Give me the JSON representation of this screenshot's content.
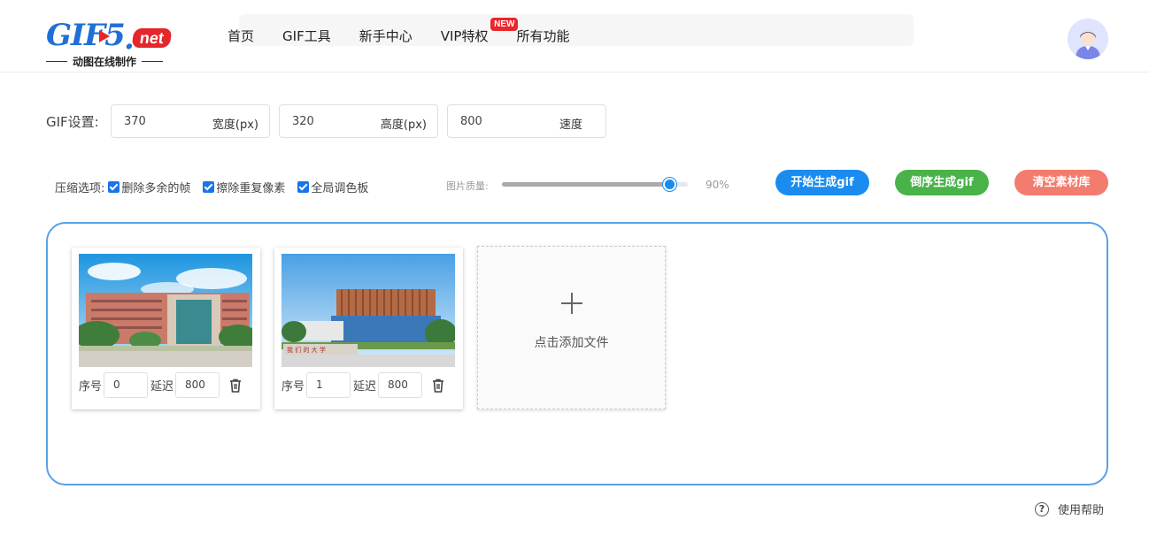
{
  "logo": {
    "main": "GIF5",
    "dot": ".",
    "net": "net",
    "subtitle": "动图在线制作"
  },
  "nav": {
    "items": [
      "首页",
      "GIF工具",
      "新手中心",
      "VIP特权",
      "所有功能"
    ],
    "badge": "NEW"
  },
  "settings": {
    "label": "GIF设置:",
    "width": {
      "value": "370",
      "unit": "宽度(px)"
    },
    "height": {
      "value": "320",
      "unit": "高度(px)"
    },
    "speed": {
      "value": "800",
      "unit": "速度"
    }
  },
  "compress": {
    "label": "压缩选项:",
    "options": [
      "删除多余的帧",
      "擦除重复像素",
      "全局调色板"
    ],
    "quality_label": "图片质量:",
    "quality_value": "90%",
    "quality_fraction": 0.9
  },
  "buttons": {
    "start": "开始生成gif",
    "reverse": "倒序生成gif",
    "clear": "清空素材库"
  },
  "frames": [
    {
      "index_label": "序号",
      "index": "0",
      "delay_label": "延迟",
      "delay": "800"
    },
    {
      "index_label": "序号",
      "index": "1",
      "delay_label": "延迟",
      "delay": "800"
    }
  ],
  "add_file": "点击添加文件",
  "help": "使用帮助",
  "colors": {
    "primary": "#1a8cf0",
    "green": "#49b34a",
    "red": "#f27c6d",
    "border": "#5aa0e6"
  }
}
